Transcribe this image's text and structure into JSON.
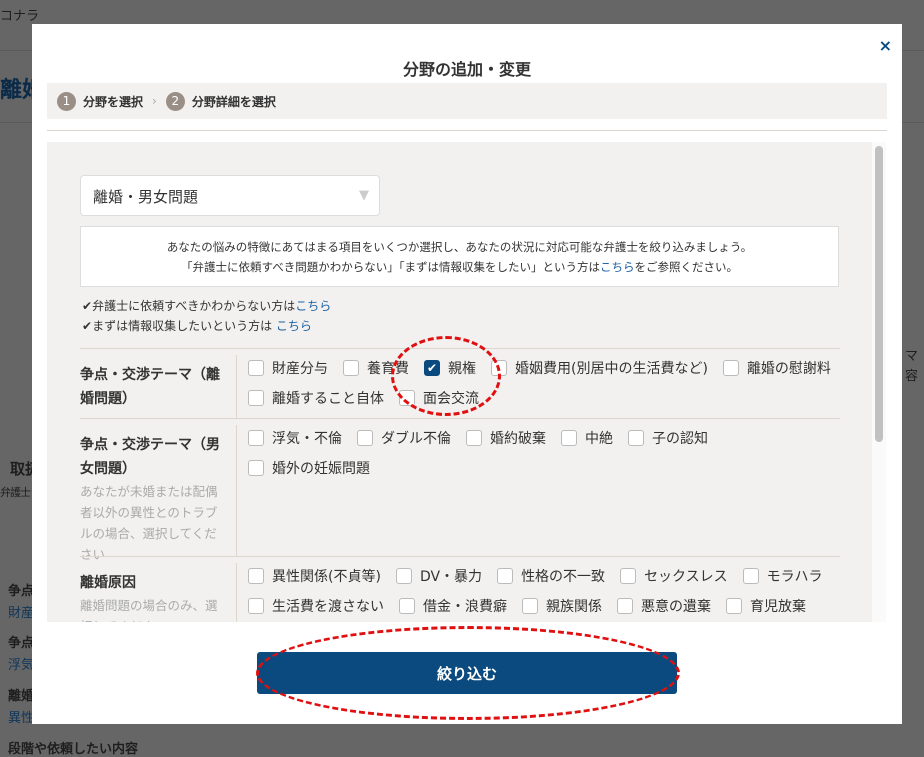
{
  "background": {
    "nav_text": "コナラ",
    "heading": "離婚",
    "section": "取扱",
    "sub": "弁護士",
    "items": [
      "争点",
      "財産",
      "争点",
      "浮気",
      "離婚",
      "異性"
    ],
    "bottom": "段階や依頼したい内容",
    "right_a": "マ",
    "right_b": "容"
  },
  "modal": {
    "title": "分野の追加・変更",
    "close": "×",
    "steps": [
      {
        "num": "1",
        "label": "分野を選択"
      },
      {
        "num": "2",
        "label": "分野詳細を選択"
      }
    ],
    "select_value": "離婚・男女問題",
    "info_line1": "あなたの悩みの特徴にあてはまる項目をいくつか選択し、あなたの状況に対応可能な弁護士を絞り込みましょう。",
    "info_line2_pre": "「弁護士に依頼すべき問題かわからない」「まずは情報収集をしたい」という方は",
    "info_line2_link": "こちら",
    "info_line2_post": "をご参照ください。",
    "check1_text": "弁護士に依頼すべきかわからない方は",
    "check1_link": "こちら",
    "check2_text": "まずは情報収集したいという方は ",
    "check2_link": "こちら",
    "sections": [
      {
        "label": "争点・交渉テーマ（離婚問題）",
        "sub": "",
        "options": [
          {
            "label": "財産分与",
            "checked": false
          },
          {
            "label": "養育費",
            "checked": false
          },
          {
            "label": "親権",
            "checked": true
          },
          {
            "label": "婚姻費用(別居中の生活費など)",
            "checked": false
          },
          {
            "label": "離婚の慰謝料",
            "checked": false
          },
          {
            "label": "離婚すること自体",
            "checked": false
          },
          {
            "label": "面会交流",
            "checked": false
          }
        ]
      },
      {
        "label": "争点・交渉テーマ（男女問題）",
        "sub": "あなたが未婚または配偶者以外の異性とのトラブルの場合、選択してください",
        "options": [
          {
            "label": "浮気・不倫",
            "checked": false
          },
          {
            "label": "ダブル不倫",
            "checked": false
          },
          {
            "label": "婚約破棄",
            "checked": false
          },
          {
            "label": "中絶",
            "checked": false
          },
          {
            "label": "子の認知",
            "checked": false
          },
          {
            "label": "婚外の妊娠問題",
            "checked": false
          }
        ]
      },
      {
        "label": "離婚原因",
        "sub": "離婚問題の場合のみ、選択してください",
        "options": [
          {
            "label": "異性関係(不貞等)",
            "checked": false
          },
          {
            "label": "DV・暴力",
            "checked": false
          },
          {
            "label": "性格の不一致",
            "checked": false
          },
          {
            "label": "セックスレス",
            "checked": false
          },
          {
            "label": "モラハラ",
            "checked": false
          },
          {
            "label": "生活費を渡さない",
            "checked": false
          },
          {
            "label": "借金・浪費癖",
            "checked": false
          },
          {
            "label": "親族関係",
            "checked": false
          },
          {
            "label": "悪意の遺棄",
            "checked": false
          },
          {
            "label": "育児放棄",
            "checked": false
          }
        ]
      }
    ],
    "submit": "絞り込む"
  },
  "colors": {
    "primary": "#0b4a7e",
    "annotation": "#e01010",
    "panel": "#f2f1ef"
  }
}
